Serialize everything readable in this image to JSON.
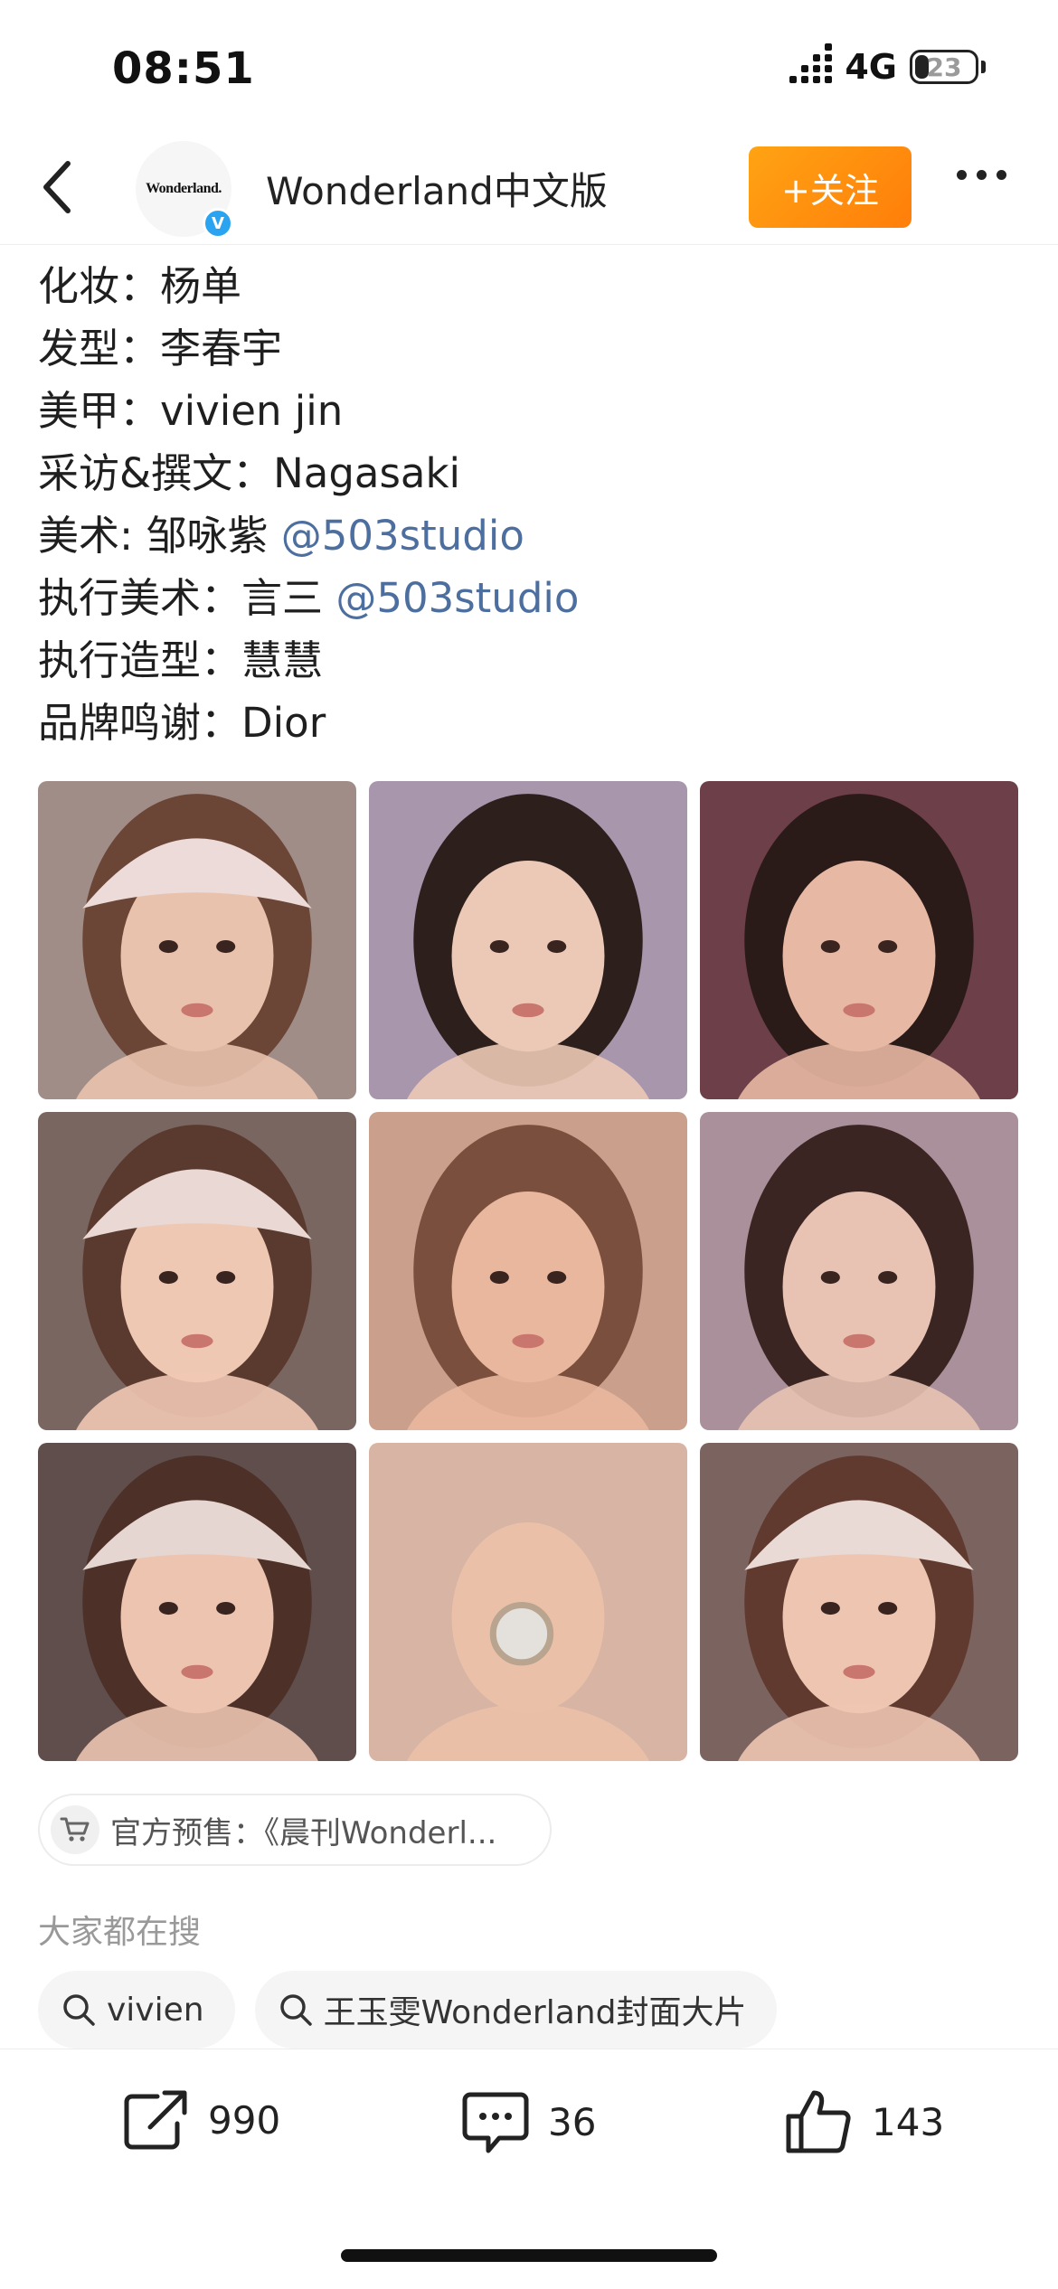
{
  "status_bar": {
    "time": "08:51",
    "network": "4G",
    "battery": "23",
    "battery_level": 0.23
  },
  "header": {
    "account_name": "Wonderland中文版",
    "avatar_logo": "Wonderland.",
    "follow_label": "+关注"
  },
  "credits": [
    {
      "label": "化妆：",
      "value": "杨单",
      "mention": ""
    },
    {
      "label": "发型：",
      "value": "李春宇",
      "mention": ""
    },
    {
      "label": "美甲：",
      "value": "vivien jin",
      "mention": ""
    },
    {
      "label": "采访&撰文：",
      "value": "Nagasaki",
      "mention": ""
    },
    {
      "label": "美术: ",
      "value": "邹咏紫 ",
      "mention": "@503studio"
    },
    {
      "label": "执行美术：",
      "value": "言三 ",
      "mention": "@503studio"
    },
    {
      "label": "执行造型：",
      "value": "慧慧",
      "mention": ""
    },
    {
      "label": "品牌鸣谢：",
      "value": "Dior",
      "mention": ""
    }
  ],
  "photos": [
    {
      "bg": "#a08d88",
      "skin": "#e9c2ad",
      "hair": "#6b4535",
      "hat": "#ecdbd8"
    },
    {
      "bg": "#a896ad",
      "skin": "#ecc9b6",
      "hair": "#2c1f1c",
      "hat": ""
    },
    {
      "bg": "#6d3f49",
      "skin": "#e7b8a3",
      "hair": "#2a1a18",
      "hat": ""
    },
    {
      "bg": "#7a6661",
      "skin": "#efc8b4",
      "hair": "#5a3a2e",
      "hat": "#e9d8d4"
    },
    {
      "bg": "#caa08d",
      "skin": "#e9b79d",
      "hair": "#7a4f3d",
      "hat": ""
    },
    {
      "bg": "#a9909a",
      "skin": "#e8c3b3",
      "hair": "#3a2522",
      "hat": ""
    },
    {
      "bg": "#5f4e4c",
      "skin": "#ecc4b0",
      "hair": "#4d3027",
      "hat": "#e6d6d2"
    },
    {
      "bg": "#d8b4a4",
      "skin": "#ebc0a8",
      "hair": "",
      "hat": ""
    },
    {
      "bg": "#7b6360",
      "skin": "#edc5b1",
      "hair": "#603a2e",
      "hat": "#eadad6"
    }
  ],
  "presale": {
    "label": "官方预售：《晨刊Wonderl..."
  },
  "trending": {
    "title": "大家都在搜",
    "queries": [
      "vivien",
      "王玉雯Wonderland封面大片"
    ]
  },
  "actions": {
    "shares": "990",
    "comments": "36",
    "likes": "143"
  }
}
